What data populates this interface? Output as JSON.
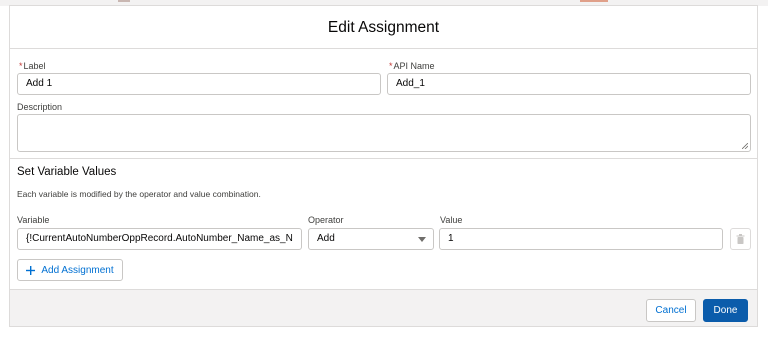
{
  "dialog": {
    "title": "Edit Assignment"
  },
  "fields": {
    "label": {
      "label": "Label",
      "required_mark": "*",
      "value": "Add 1"
    },
    "api_name": {
      "label": "API Name",
      "required_mark": "*",
      "value": "Add_1"
    },
    "description": {
      "label": "Description",
      "value": ""
    }
  },
  "section": {
    "title": "Set Variable Values",
    "help_text": "Each variable is modified by the operator and value combination."
  },
  "assignment_columns": {
    "variable": "Variable",
    "operator": "Operator",
    "value": "Value"
  },
  "assignment_row": {
    "variable": "{!CurrentAutoNumberOppRecord.AutoNumber_Name_as_N",
    "operator": "Add",
    "value": "1"
  },
  "add_assignment_label": "Add Assignment",
  "footer": {
    "cancel_label": "Cancel",
    "done_label": "Done"
  },
  "colors": {
    "brand": "#0b5cab",
    "link": "#0070d2",
    "required": "#c23934",
    "footer_bg": "#f3f2f2"
  },
  "icons": {
    "add": "plus-icon",
    "delete": "trash-icon",
    "operator_dropdown": "chevron-down-icon",
    "textarea_resize": "resize-handle-icon"
  }
}
